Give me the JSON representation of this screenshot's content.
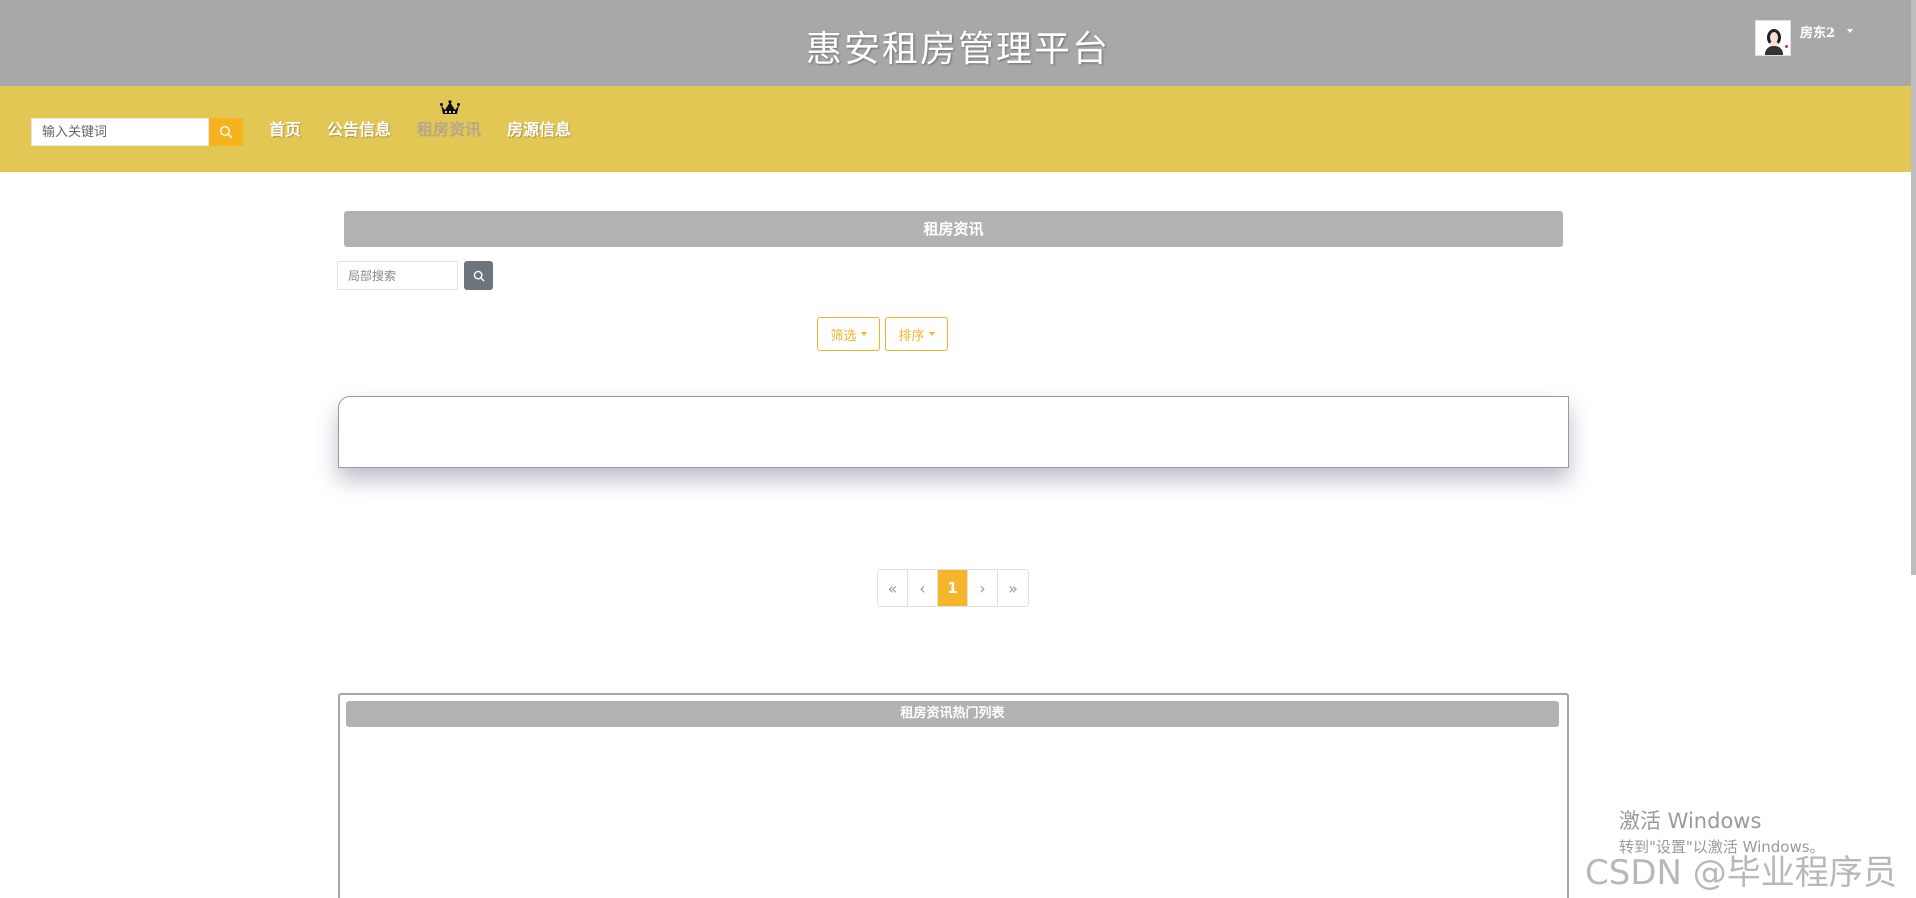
{
  "header": {
    "site_title": "惠安租房管理平台",
    "user_name": "房东2"
  },
  "nav": {
    "search_placeholder": "输入关键词",
    "items": [
      {
        "label": "首页"
      },
      {
        "label": "公告信息"
      },
      {
        "label": "租房资讯",
        "active": true
      },
      {
        "label": "房源信息"
      }
    ]
  },
  "main": {
    "section_title": "租房资讯",
    "local_search_placeholder": "局部搜索",
    "filter_label": "筛选",
    "sort_label": "排序",
    "pagination": {
      "first": "«",
      "prev": "‹",
      "current": "1",
      "next": "›",
      "last": "»"
    },
    "hot_list_title": "租房资讯热门列表"
  },
  "overlay": {
    "activate_line1": "激活 Windows",
    "activate_line2": "转到\"设置\"以激活 Windows。",
    "watermark": "CSDN @毕业程序员"
  },
  "colors": {
    "header_bg": "#a8a8a8",
    "nav_bg": "#e3c755",
    "accent": "#f7b52c",
    "section_title_bg": "#b2b2b2"
  }
}
